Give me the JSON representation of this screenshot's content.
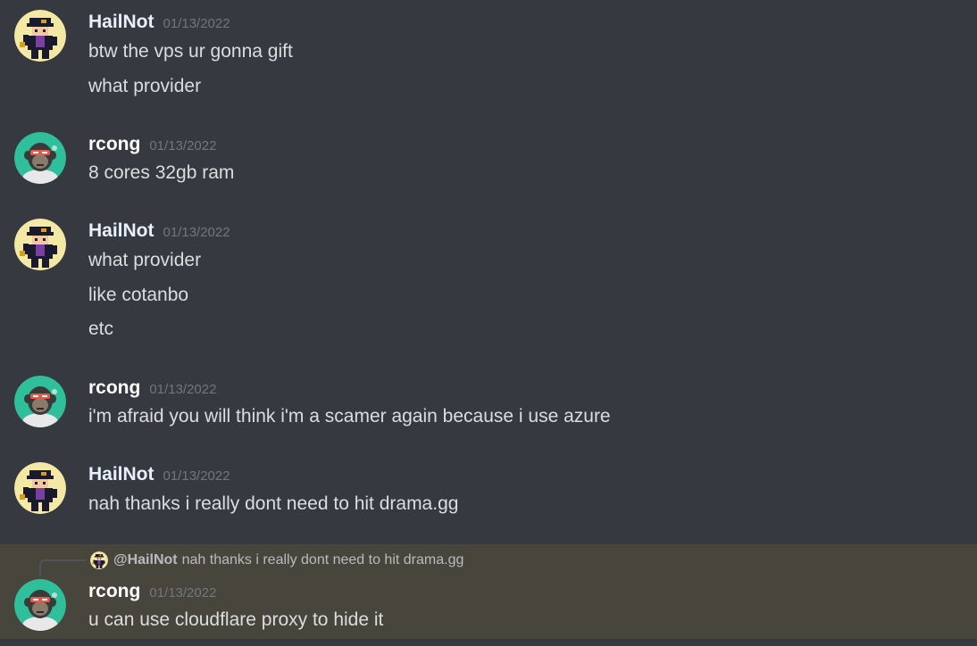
{
  "colors": {
    "background": "#36393f",
    "highlight_background": "#48453d",
    "message_text": "#dcddde",
    "username": "#ffffff",
    "timestamp": "#72767d"
  },
  "messages": [
    {
      "username": "HailNot",
      "timestamp": "01/13/2022",
      "avatar_icon": "jotaro-avatar-icon",
      "lines": [
        "btw the vps ur gonna gift",
        "what provider"
      ]
    },
    {
      "username": "rcong",
      "timestamp": "01/13/2022",
      "avatar_icon": "ape-avatar-icon",
      "lines": [
        "8 cores 32gb ram"
      ]
    },
    {
      "username": "HailNot",
      "timestamp": "01/13/2022",
      "avatar_icon": "jotaro-avatar-icon",
      "lines": [
        "what provider",
        "like cotanbo",
        "etc"
      ]
    },
    {
      "username": "rcong",
      "timestamp": "01/13/2022",
      "avatar_icon": "ape-avatar-icon",
      "lines": [
        "i'm afraid you will think i'm a scamer again because i use azure"
      ]
    },
    {
      "username": "HailNot",
      "timestamp": "01/13/2022",
      "avatar_icon": "jotaro-avatar-icon",
      "lines": [
        "nah thanks i really dont need to hit drama.gg"
      ]
    },
    {
      "username": "rcong",
      "timestamp": "01/13/2022",
      "avatar_icon": "ape-avatar-icon",
      "lines": [
        "u can use cloudflare proxy to hide it"
      ],
      "reply": {
        "mention": "@HailNot",
        "text": "nah thanks i really dont need to hit drama.gg"
      }
    }
  ]
}
